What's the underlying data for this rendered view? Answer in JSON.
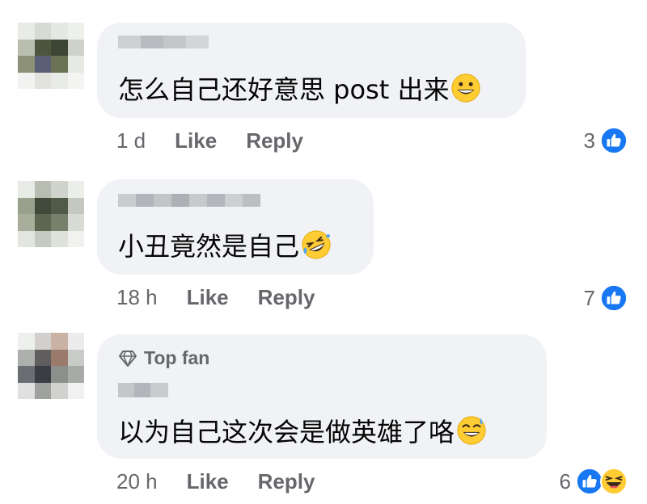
{
  "comments": [
    {
      "topfan": "",
      "text": "怎么自己还好意思 post 出来",
      "emoji": "grinning-face",
      "time": "1 d",
      "like_label": "Like",
      "reply_label": "Reply",
      "reaction_count": "3",
      "reactions": [
        "like"
      ]
    },
    {
      "topfan": "",
      "text": "小丑竟然是自己",
      "emoji": "rolling-laughing-face",
      "time": "18 h",
      "like_label": "Like",
      "reply_label": "Reply",
      "reaction_count": "7",
      "reactions": [
        "like"
      ]
    },
    {
      "topfan": "Top fan",
      "text": "以为自己这次会是做英雄了咯",
      "emoji": "grinning-sweat-face",
      "time": "20 h",
      "like_label": "Like",
      "reply_label": "Reply",
      "reaction_count": "6",
      "reactions": [
        "like",
        "haha"
      ]
    }
  ],
  "colors": {
    "bubble": "#f0f2f5",
    "meta_text": "#65676b",
    "like_blue": "#1877f2",
    "emoji_yellow": "#ffcc33"
  }
}
